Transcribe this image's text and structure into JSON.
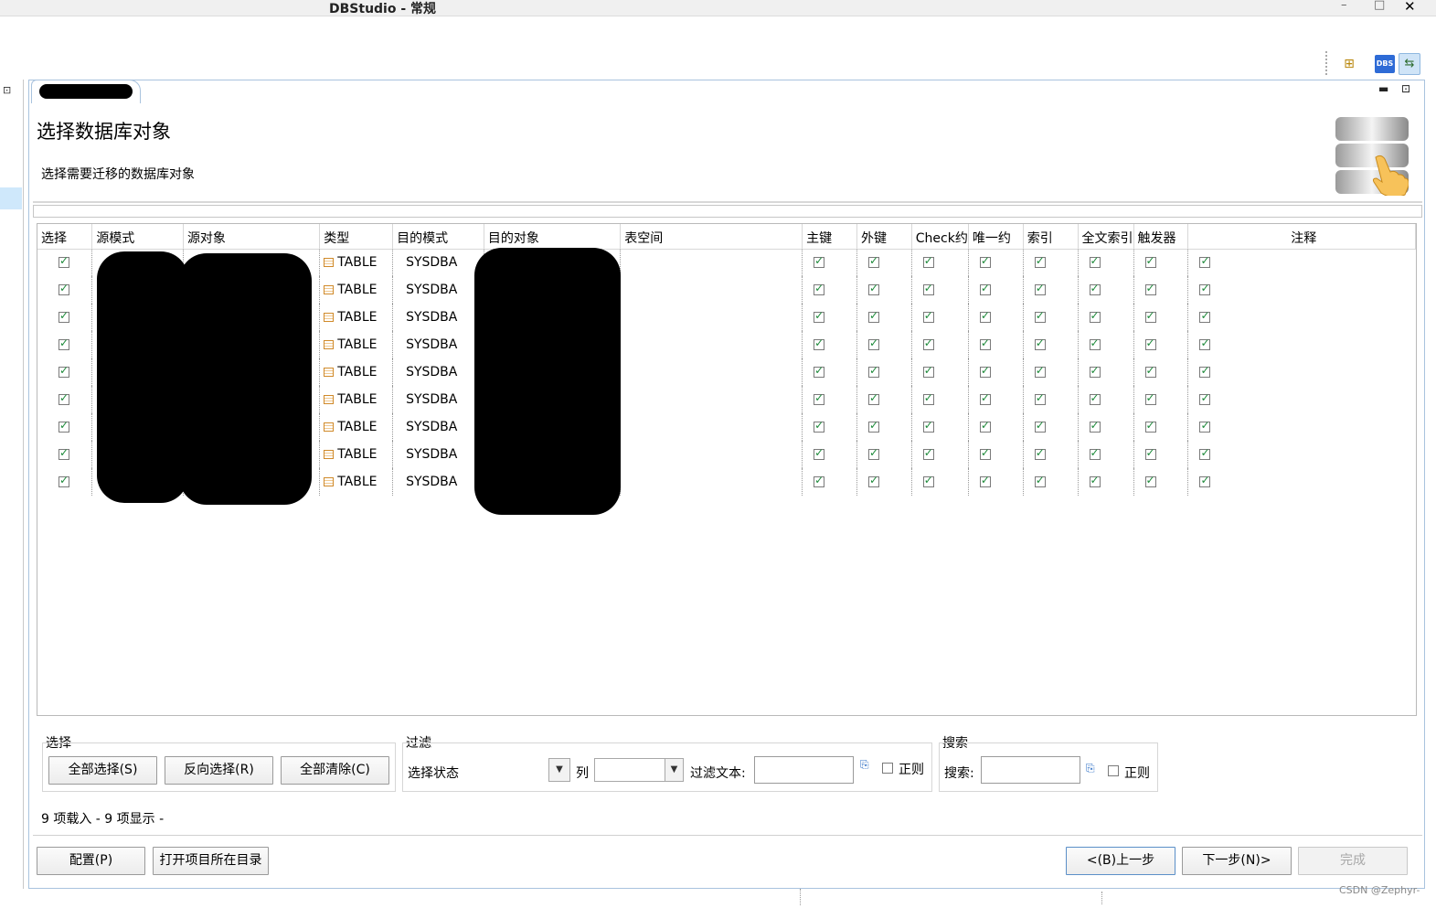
{
  "window": {
    "title": "DBStudio - 常规",
    "controls": {
      "minimize": "–",
      "maximize": "□",
      "close": "✕"
    }
  },
  "perspective": {
    "icons": [
      "open-perspective-icon",
      "dbs-icon",
      "migration-perspective-icon"
    ],
    "dbs_text": "DBS"
  },
  "editor": {
    "tab_icon": "grid-icon"
  },
  "wizard": {
    "title": "选择数据库对象",
    "description": "选择需要迁移的数据库对象"
  },
  "table": {
    "columns": [
      "选择",
      "源模式",
      "源对象",
      "类型",
      "目的模式",
      "目的对象",
      "表空间",
      "主键",
      "外键",
      "Check约",
      "唯一约",
      "索引",
      "全文索引",
      "触发器",
      "注释"
    ],
    "rows": [
      {
        "type": "TABLE",
        "dest_schema": "SYSDBA"
      },
      {
        "type": "TABLE",
        "dest_schema": "SYSDBA"
      },
      {
        "type": "TABLE",
        "dest_schema": "SYSDBA"
      },
      {
        "type": "TABLE",
        "dest_schema": "SYSDBA"
      },
      {
        "type": "TABLE",
        "dest_schema": "SYSDBA"
      },
      {
        "type": "TABLE",
        "dest_schema": "SYSDBA"
      },
      {
        "type": "TABLE",
        "dest_schema": "SYSDBA"
      },
      {
        "type": "TABLE",
        "dest_schema": "SYSDBA"
      },
      {
        "type": "TABLE",
        "dest_schema": "SYSDBA"
      }
    ]
  },
  "select_group": {
    "label": "选择",
    "select_all": "全部选择(S)",
    "invert": "反向选择(R)",
    "clear_all": "全部清除(C)"
  },
  "filter_group": {
    "label": "过滤",
    "state_value": "选择状态",
    "column_label": "列",
    "column_value": "",
    "text_label": "过滤文本:",
    "text_value": "",
    "regex_label": "正则"
  },
  "search_group": {
    "label": "搜索",
    "search_label": "搜索:",
    "search_value": "",
    "regex_label": "正则"
  },
  "status": "9 项载入 - 9 项显示 -",
  "footer": {
    "config": "配置(P)",
    "open_dir": "打开项目所在目录",
    "back": "<(B)上一步",
    "next": "下一步(N)>",
    "finish": "完成"
  },
  "watermark": "CSDN @Zephyr-"
}
